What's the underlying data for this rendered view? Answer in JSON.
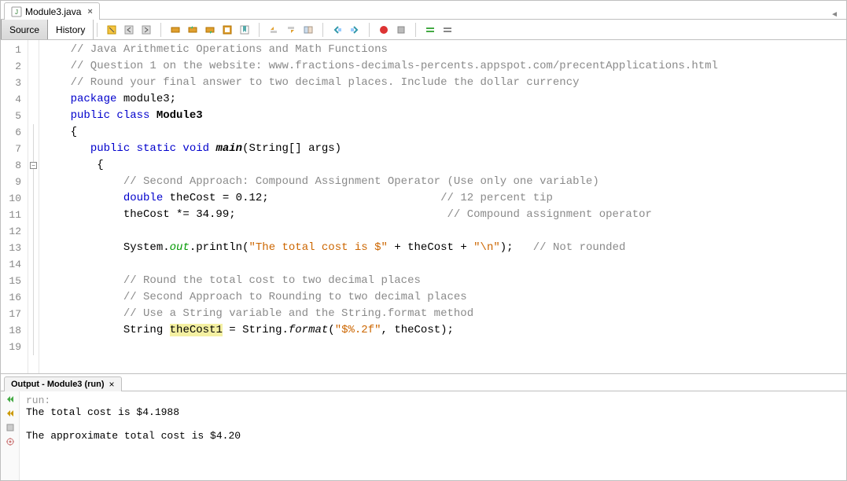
{
  "file_tab": {
    "name": "Module3.java",
    "close": "×"
  },
  "view_tabs": {
    "source": "Source",
    "history": "History"
  },
  "code": {
    "lines": [
      {
        "n": 1,
        "segs": [
          {
            "cls": "c-comment",
            "t": "    // Java Arithmetic Operations and Math Functions"
          }
        ]
      },
      {
        "n": 2,
        "segs": [
          {
            "cls": "c-comment",
            "t": "    // Question 1 on the website: www.fractions-decimals-percents.appspot.com/precentApplications.html"
          }
        ]
      },
      {
        "n": 3,
        "segs": [
          {
            "cls": "c-comment",
            "t": "    // Round your final answer to two decimal places. Include the dollar currency"
          }
        ]
      },
      {
        "n": 4,
        "segs": [
          {
            "cls": "c-key",
            "t": "    package"
          },
          {
            "cls": "c-ident",
            "t": " module3;"
          }
        ]
      },
      {
        "n": 5,
        "segs": [
          {
            "cls": "c-key",
            "t": "    public class "
          },
          {
            "cls": "c-ident c-bold",
            "t": "Module3"
          }
        ]
      },
      {
        "n": 6,
        "segs": [
          {
            "cls": "c-ident",
            "t": "    {"
          }
        ]
      },
      {
        "n": 7,
        "segs": [
          {
            "cls": "c-ident",
            "t": "       "
          },
          {
            "cls": "c-key",
            "t": "public static void "
          },
          {
            "cls": "c-ident c-bold c-italic",
            "t": "main"
          },
          {
            "cls": "c-ident",
            "t": "(String[] args)"
          }
        ]
      },
      {
        "n": 8,
        "fold": "minus",
        "segs": [
          {
            "cls": "c-ident",
            "t": "        {"
          }
        ]
      },
      {
        "n": 9,
        "segs": [
          {
            "cls": "c-comment",
            "t": "            // Second Approach: Compound Assignment Operator (Use only one variable)"
          }
        ]
      },
      {
        "n": 10,
        "segs": [
          {
            "cls": "c-ident",
            "t": "            "
          },
          {
            "cls": "c-key",
            "t": "double"
          },
          {
            "cls": "c-ident",
            "t": " theCost = 0.12;                          "
          },
          {
            "cls": "c-comment",
            "t": "// 12 percent tip"
          }
        ]
      },
      {
        "n": 11,
        "segs": [
          {
            "cls": "c-ident",
            "t": "            theCost *= 34.99;                                "
          },
          {
            "cls": "c-comment",
            "t": "// Compound assignment operator"
          }
        ]
      },
      {
        "n": 12,
        "segs": [
          {
            "cls": "c-ident",
            "t": ""
          }
        ]
      },
      {
        "n": 13,
        "segs": [
          {
            "cls": "c-ident",
            "t": "            System."
          },
          {
            "cls": "c-static",
            "t": "out"
          },
          {
            "cls": "c-ident",
            "t": ".println("
          },
          {
            "cls": "c-string",
            "t": "\"The total cost is $\""
          },
          {
            "cls": "c-ident",
            "t": " + theCost + "
          },
          {
            "cls": "c-string",
            "t": "\"\\n\""
          },
          {
            "cls": "c-ident",
            "t": ");   "
          },
          {
            "cls": "c-comment",
            "t": "// Not rounded"
          }
        ]
      },
      {
        "n": 14,
        "segs": [
          {
            "cls": "c-ident",
            "t": ""
          }
        ]
      },
      {
        "n": 15,
        "segs": [
          {
            "cls": "c-comment",
            "t": "            // Round the total cost to two decimal places"
          }
        ]
      },
      {
        "n": 16,
        "segs": [
          {
            "cls": "c-comment",
            "t": "            // Second Approach to Rounding to two decimal places"
          }
        ]
      },
      {
        "n": 17,
        "segs": [
          {
            "cls": "c-comment",
            "t": "            // Use a String variable and the String.format method"
          }
        ]
      },
      {
        "n": 18,
        "segs": [
          {
            "cls": "c-ident",
            "t": "            String "
          },
          {
            "cls": "c-ident c-hl",
            "t": "theCost1"
          },
          {
            "cls": "c-ident",
            "t": " = String."
          },
          {
            "cls": "c-ident c-italic",
            "t": "format"
          },
          {
            "cls": "c-ident",
            "t": "("
          },
          {
            "cls": "c-string",
            "t": "\"$%.2f\""
          },
          {
            "cls": "c-ident",
            "t": ", theCost);"
          }
        ]
      },
      {
        "n": 19,
        "segs": [
          {
            "cls": "c-ident",
            "t": ""
          }
        ]
      }
    ]
  },
  "output": {
    "tab_title": "Output - Module3 (run)",
    "close": "×",
    "lines": [
      {
        "cls": "run-gray",
        "t": "run:"
      },
      {
        "cls": "",
        "t": "The total cost is $4.1988"
      },
      {
        "cls": "",
        "t": ""
      },
      {
        "cls": "",
        "t": "The approximate total cost is $4.20"
      }
    ]
  },
  "icons": {
    "java": "#",
    "back": "←",
    "fwd": "→"
  }
}
